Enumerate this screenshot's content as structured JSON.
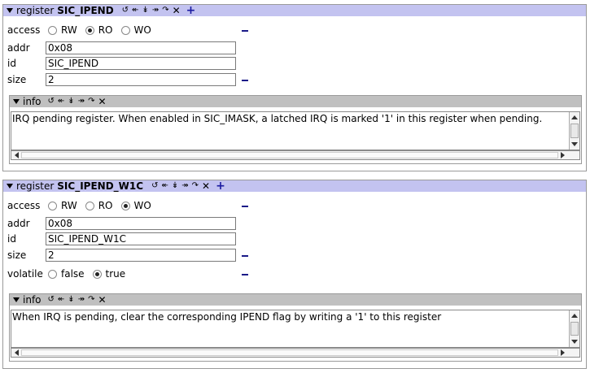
{
  "panels": [
    {
      "header": {
        "keyword": "register",
        "name": "SIC_IPEND"
      },
      "access": {
        "label": "access",
        "options": [
          "RW",
          "RO",
          "WO"
        ],
        "selected": "RO"
      },
      "addr": {
        "label": "addr",
        "value": "0x08"
      },
      "id": {
        "label": "id",
        "value": "SIC_IPEND"
      },
      "size": {
        "label": "size",
        "value": "2"
      },
      "info": {
        "label": "info",
        "text": "IRQ pending register. When enabled in SIC_IMASK, a latched IRQ is marked '1' in this register when pending."
      }
    },
    {
      "header": {
        "keyword": "register",
        "name": "SIC_IPEND_W1C"
      },
      "access": {
        "label": "access",
        "options": [
          "RW",
          "RO",
          "WO"
        ],
        "selected": "WO"
      },
      "addr": {
        "label": "addr",
        "value": "0x08"
      },
      "id": {
        "label": "id",
        "value": "SIC_IPEND_W1C"
      },
      "size": {
        "label": "size",
        "value": "2"
      },
      "volatile": {
        "label": "volatile",
        "options": [
          "false",
          "true"
        ],
        "selected": "true"
      },
      "info": {
        "label": "info",
        "text": "When IRQ is pending, clear the corresponding IPEND flag by writing a '1' to this register"
      }
    }
  ],
  "toolbar_icons": [
    "reload-icon",
    "move-left-icon",
    "move-down-icon",
    "move-right-icon",
    "redo-icon",
    "close-icon",
    "add-icon"
  ],
  "colors": {
    "header_bg": "#c3c3f0",
    "info_header_bg": "#c0c0c0",
    "accent": "#1a1a88"
  }
}
